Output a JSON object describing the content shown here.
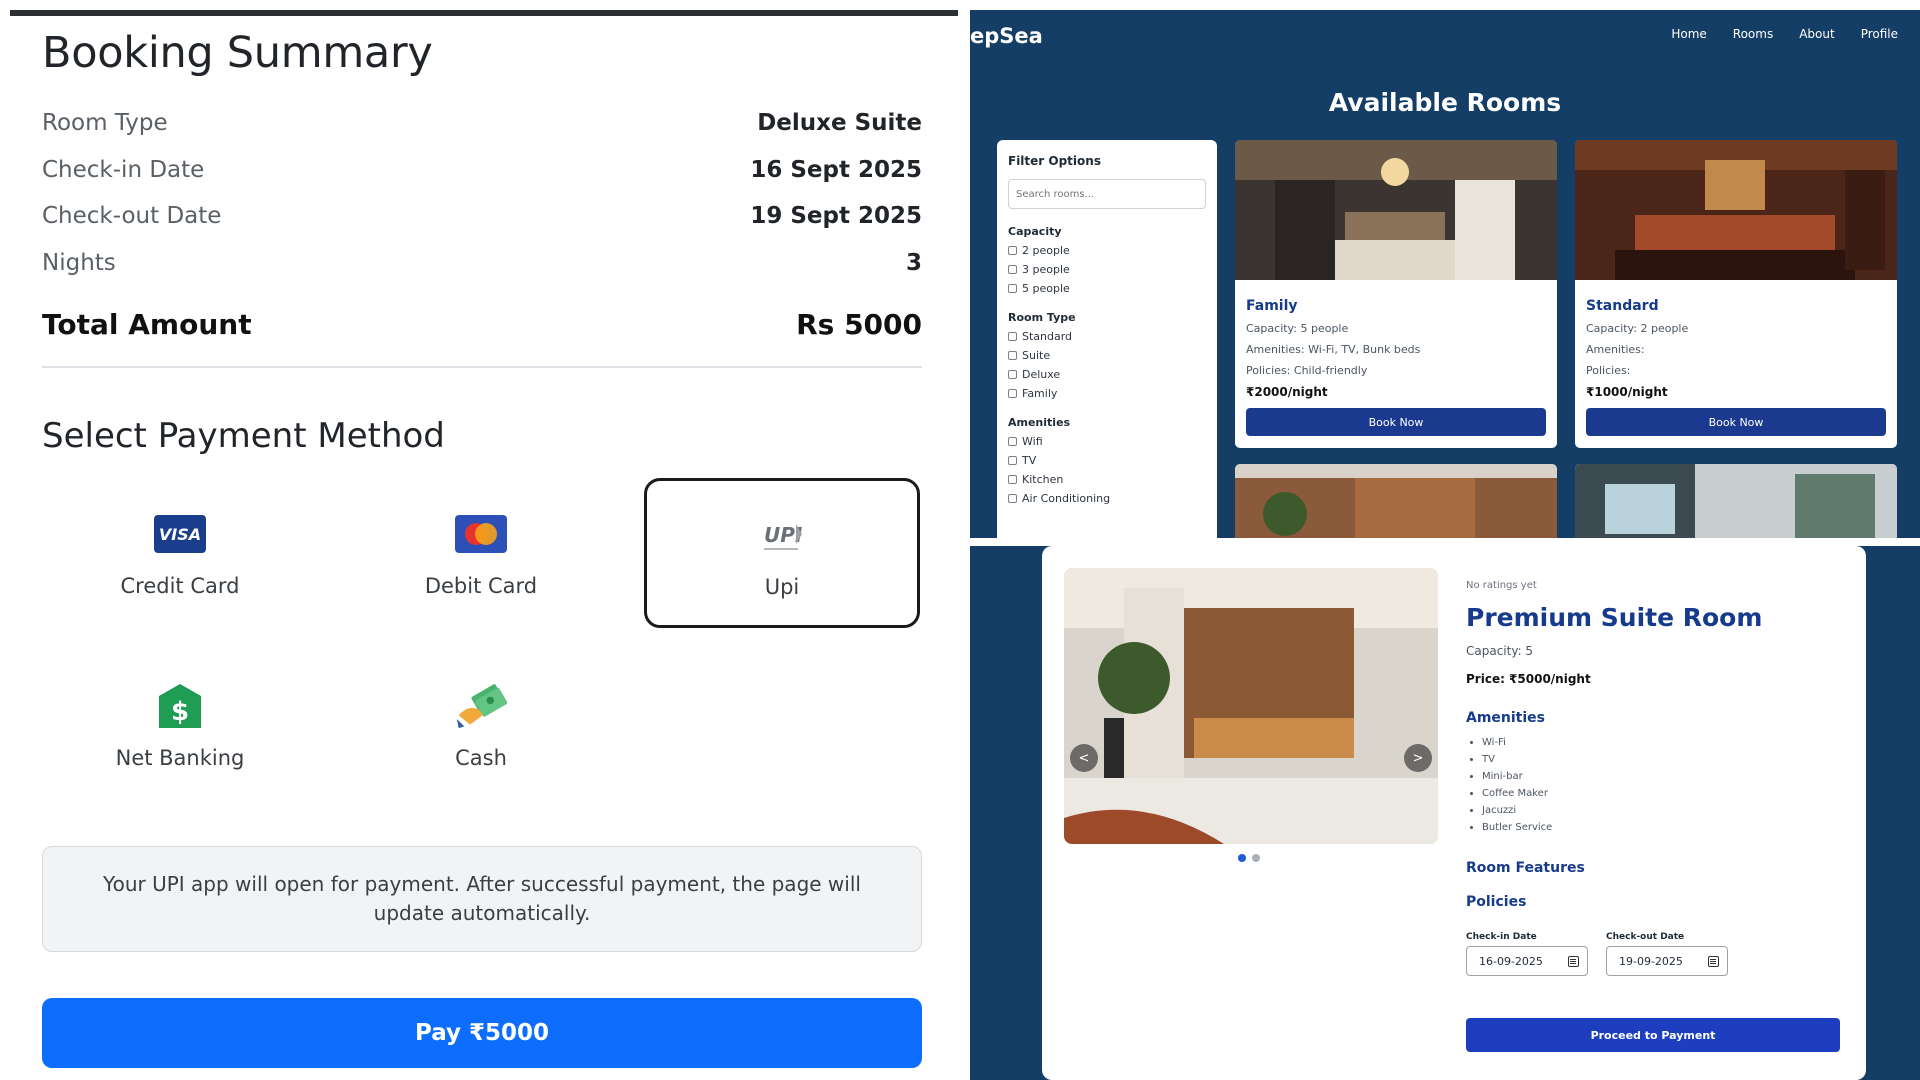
{
  "booking": {
    "title": "Booking Summary",
    "rows": [
      {
        "label": "Room Type",
        "value": "Deluxe Suite"
      },
      {
        "label": "Check-in Date",
        "value": "16 Sept 2025"
      },
      {
        "label": "Check-out Date",
        "value": "19 Sept 2025"
      },
      {
        "label": "Nights",
        "value": "3"
      }
    ],
    "total_label": "Total Amount",
    "total_value": "Rs 5000",
    "payment_title": "Select Payment Method",
    "methods": [
      {
        "label": "Credit Card",
        "icon": "visa-icon"
      },
      {
        "label": "Debit Card",
        "icon": "mastercard-icon"
      },
      {
        "label": "Upi",
        "icon": "upi-icon",
        "selected": true
      },
      {
        "label": "Net Banking",
        "icon": "dollar-icon"
      },
      {
        "label": "Cash",
        "icon": "cash-icon"
      }
    ],
    "upi_info": "Your UPI app will open for payment. After successful payment, the page will update automatically.",
    "pay_label": "Pay ₹5000",
    "colors": {
      "primary": "#0d6efd",
      "text": "#212529"
    }
  },
  "rooms": {
    "brand": "epSea",
    "nav": [
      "Home",
      "Rooms",
      "About",
      "Profile"
    ],
    "heading": "Available Rooms",
    "filter": {
      "title": "Filter Options",
      "search_placeholder": "Search rooms...",
      "groups": [
        {
          "title": "Capacity",
          "options": [
            "2 people",
            "3 people",
            "5 people"
          ]
        },
        {
          "title": "Room Type",
          "options": [
            "Standard",
            "Suite",
            "Deluxe",
            "Family"
          ]
        },
        {
          "title": "Amenities",
          "options": [
            "Wifi",
            "TV",
            "Kitchen",
            "Air Conditioning"
          ]
        }
      ]
    },
    "cards": [
      {
        "name": "Family",
        "capacity": "Capacity: 5 people",
        "amenities": "Amenities: Wi-Fi, TV, Bunk beds",
        "policies": "Policies: Child-friendly",
        "price": "₹2000/night",
        "button": "Book Now"
      },
      {
        "name": "Standard",
        "capacity": "Capacity: 2 people",
        "amenities": "Amenities:",
        "policies": "Policies:",
        "price": "₹1000/night",
        "button": "Book Now"
      }
    ],
    "colors": {
      "background": "#153e66",
      "button": "#1b3a8f"
    }
  },
  "detail": {
    "rating": "No ratings yet",
    "title": "Premium Suite Room",
    "capacity": "Capacity: 5",
    "price": "Price: ₹5000/night",
    "amenities_title": "Amenities",
    "amenities": [
      "Wi-Fi",
      "TV",
      "Mini-bar",
      "Coffee Maker",
      "Jacuzzi",
      "Butler Service"
    ],
    "features_title": "Room Features",
    "policies_title": "Policies",
    "checkin_label": "Check-in Date",
    "checkin_value": "16-09-2025",
    "checkout_label": "Check-out Date",
    "checkout_value": "19-09-2025",
    "prev": "<",
    "next": ">",
    "proceed_label": "Proceed to Payment"
  }
}
